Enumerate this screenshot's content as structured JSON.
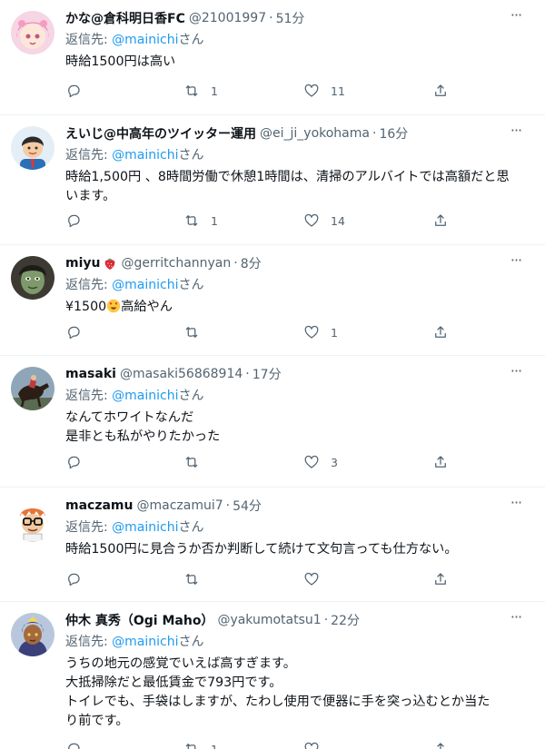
{
  "tweets": [
    {
      "name": "かな@倉科明日香FC",
      "handle": "@21001997",
      "time": "51分",
      "reply_prefix": "返信先: ",
      "reply_to": "@mainichi",
      "reply_suffix": "さん",
      "text": "時給1500円は高い",
      "replies": "",
      "retweets": "1",
      "likes": "11"
    },
    {
      "name": "えいじ@中高年のツイッター運用",
      "handle": "@ei_ji_yokohama",
      "time": "16分",
      "reply_prefix": "返信先: ",
      "reply_to": "@mainichi",
      "reply_suffix": "さん",
      "text": "時給1,500円 、8時間労働で休憩1時間は、清掃のアルバイトでは高額だと思\nいます。",
      "replies": "",
      "retweets": "1",
      "likes": "14"
    },
    {
      "name": "miyu",
      "handle": "@gerritchannyan",
      "time": "8分",
      "reply_prefix": "返信先: ",
      "reply_to": "@mainichi",
      "reply_suffix": "さん",
      "text_before": "¥1500",
      "text_after": "高給やん",
      "replies": "",
      "retweets": "",
      "likes": "1"
    },
    {
      "name": "masaki",
      "handle": "@masaki56868914",
      "time": "17分",
      "reply_prefix": "返信先: ",
      "reply_to": "@mainichi",
      "reply_suffix": "さん",
      "text": "なんてホワイトなんだ\n是非とも私がやりたかった",
      "replies": "",
      "retweets": "",
      "likes": "3"
    },
    {
      "name": "maczamu",
      "handle": "@maczamui7",
      "time": "54分",
      "reply_prefix": "返信先: ",
      "reply_to": "@mainichi",
      "reply_suffix": "さん",
      "text": "時給1500円に見合うか否か判断して続けて文句言っても仕方ない。",
      "replies": "",
      "retweets": "",
      "likes": ""
    },
    {
      "name": "仲木 真秀（Ogi Maho）",
      "handle": "@yakumotatsu1",
      "time": "22分",
      "reply_prefix": "返信先: ",
      "reply_to": "@mainichi",
      "reply_suffix": "さん",
      "text": "うちの地元の感覚でいえば高すぎます。\n大抵掃除だと最低賃金で793円です。\nトイレでも、手袋はしますが、たわし使用で便器に手を突っ込むとか当た\nり前です。",
      "replies": "",
      "retweets": "1",
      "likes": ""
    }
  ],
  "separator": "·",
  "colors": {
    "accent": "#1d9bf0",
    "muted": "#536471",
    "text": "#0f1419",
    "border": "#eff3f4"
  },
  "icons": [
    "reply-icon",
    "retweet-icon",
    "like-icon",
    "share-icon",
    "more-icon",
    "strawberry-emoji",
    "heart-eyes-emoji"
  ]
}
